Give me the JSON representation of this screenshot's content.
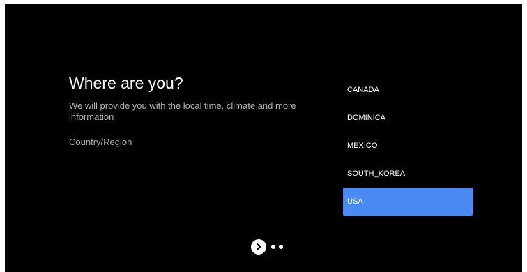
{
  "setup": {
    "title": "Where are you?",
    "description": "We will provide you with the local time, climate and more information",
    "field_label": "Country/Region"
  },
  "countries": {
    "items": [
      {
        "label": "CANADA",
        "selected": false
      },
      {
        "label": "DOMINICA",
        "selected": false
      },
      {
        "label": "MEXICO",
        "selected": false
      },
      {
        "label": "SOUTH_KOREA",
        "selected": false
      },
      {
        "label": "USA",
        "selected": true
      }
    ],
    "selected_value": "USA"
  },
  "pager": {
    "next_icon": "chevron-right-icon",
    "page_count": 2
  },
  "colors": {
    "background": "#000000",
    "selection": "#4a8af4",
    "primary_text": "#ffffff",
    "secondary_text": "#b3b3b3"
  }
}
